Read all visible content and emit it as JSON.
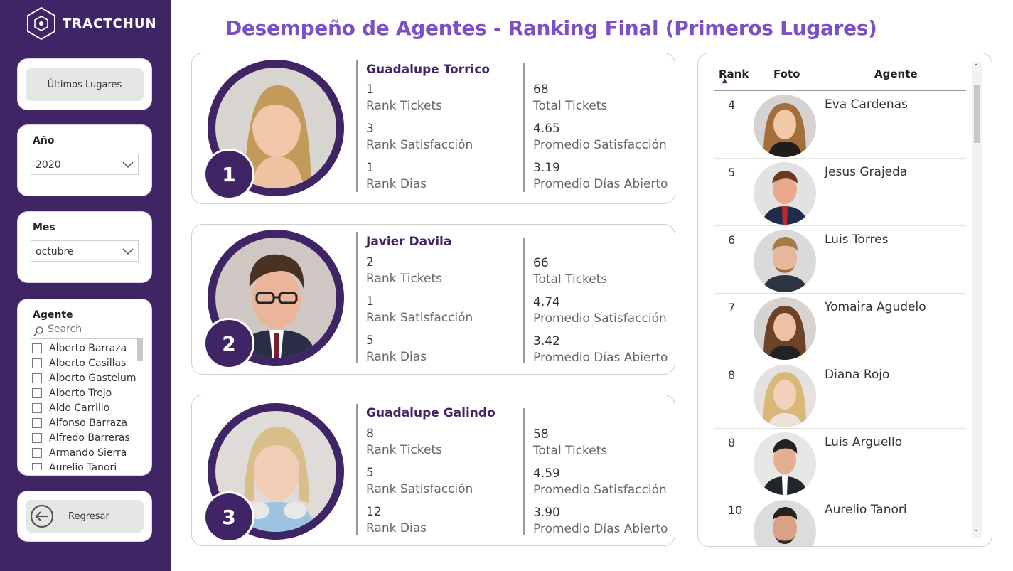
{
  "brand": {
    "name": "TRACTCHUN"
  },
  "sidebar": {
    "last_places_button": "Últimos Lugares",
    "year_filter": {
      "title": "Año",
      "value": "2020"
    },
    "month_filter": {
      "title": "Mes",
      "value": "octubre"
    },
    "agent_filter": {
      "title": "Agente",
      "search_placeholder": "Search",
      "items": [
        "Alberto Barraza",
        "Alberto Casillas",
        "Alberto Gastelum",
        "Alberto Trejo",
        "Aldo Carrillo",
        "Alfonso Barraza",
        "Alfredo Barreras",
        "Armando Sierra",
        "Aurelio Tanori"
      ]
    },
    "back_button": "Regresar"
  },
  "page": {
    "title": "Desempeño de Agentes - Ranking Final (Primeros Lugares)"
  },
  "podium": [
    {
      "rank": "1",
      "name": "Guadalupe Torrico",
      "rank_tickets": "1",
      "rank_tickets_label": "Rank Tickets",
      "rank_satisfaction": "3",
      "rank_satisfaction_label": "Rank Satisfacción",
      "rank_days": "1",
      "rank_days_label": "Rank Dias",
      "total_tickets": "68",
      "total_tickets_label": "Total Tickets",
      "avg_satisfaction": "4.65",
      "avg_satisfaction_label": "Promedio Satisfacción",
      "avg_days_open": "3.19",
      "avg_days_open_label": "Promedio Días Abierto"
    },
    {
      "rank": "2",
      "name": "Javier Davila",
      "rank_tickets": "2",
      "rank_tickets_label": "Rank Tickets",
      "rank_satisfaction": "1",
      "rank_satisfaction_label": "Rank Satisfacción",
      "rank_days": "5",
      "rank_days_label": "Rank Dias",
      "total_tickets": "66",
      "total_tickets_label": "Total Tickets",
      "avg_satisfaction": "4.74",
      "avg_satisfaction_label": "Promedio Satisfacción",
      "avg_days_open": "3.42",
      "avg_days_open_label": "Promedio Días Abierto"
    },
    {
      "rank": "3",
      "name": "Guadalupe Galindo",
      "rank_tickets": "8",
      "rank_tickets_label": "Rank Tickets",
      "rank_satisfaction": "5",
      "rank_satisfaction_label": "Rank Satisfacción",
      "rank_days": "12",
      "rank_days_label": "Rank Dias",
      "total_tickets": "58",
      "total_tickets_label": "Total Tickets",
      "avg_satisfaction": "4.59",
      "avg_satisfaction_label": "Promedio Satisfacción",
      "avg_days_open": "3.90",
      "avg_days_open_label": "Promedio Días Abierto"
    }
  ],
  "ranking_table": {
    "columns": [
      "Rank",
      "Foto",
      "Agente"
    ],
    "sort_indicator": "▲",
    "rows": [
      {
        "rank": "4",
        "agent": "Eva Cardenas"
      },
      {
        "rank": "5",
        "agent": "Jesus Grajeda"
      },
      {
        "rank": "6",
        "agent": "Luis Torres"
      },
      {
        "rank": "7",
        "agent": "Yomaira Agudelo"
      },
      {
        "rank": "8",
        "agent": "Diana Rojo"
      },
      {
        "rank": "8",
        "agent": "Luis Arguello"
      },
      {
        "rank": "10",
        "agent": "Aurelio Tanori"
      }
    ]
  },
  "colors": {
    "sidebar": "#3f2566",
    "title": "#7a4fc8",
    "accent": "#3f2566"
  },
  "icons": {
    "logo": "hexagon-logo-icon",
    "back": "arrow-left-circle-icon",
    "search": "search-icon",
    "dropdown": "chevron-down-icon"
  }
}
